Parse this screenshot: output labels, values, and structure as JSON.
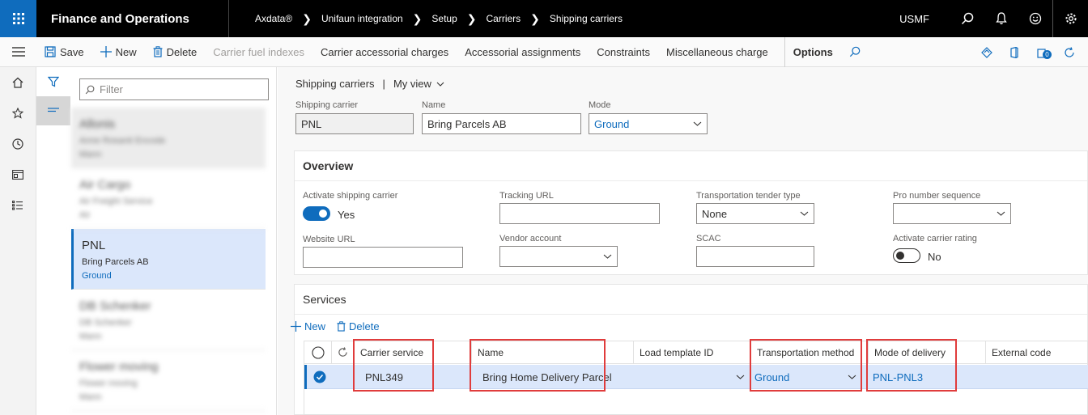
{
  "topbar": {
    "app_title": "Finance and Operations",
    "breadcrumbs": [
      "Axdata®",
      "Unifaun integration",
      "Setup",
      "Carriers",
      "Shipping carriers"
    ],
    "company": "USMF"
  },
  "actionbar": {
    "save": "Save",
    "new": "New",
    "delete": "Delete",
    "carrier_fuel_indexes": "Carrier fuel indexes",
    "carrier_accessorial_charges": "Carrier accessorial charges",
    "accessorial_assignments": "Accessorial assignments",
    "constraints": "Constraints",
    "miscellaneous_charge": "Miscellaneous charge",
    "options": "Options",
    "notification_count": "0"
  },
  "listpane": {
    "filter_placeholder": "Filter",
    "items": [
      {
        "code": "Allonis",
        "name": "Anne Rosanti Encode",
        "mode": "Mann",
        "blurred": true
      },
      {
        "code": "Air Cargo",
        "name": "Air Freight Service",
        "mode": "Air",
        "blurred": true
      },
      {
        "code": "PNL",
        "name": "Bring Parcels AB",
        "mode": "Ground",
        "blurred": false
      },
      {
        "code": "DB Schenker",
        "name": "DB Schenker",
        "mode": "Mann",
        "blurred": true
      },
      {
        "code": "Flower moving",
        "name": "Flower moving",
        "mode": "Mann",
        "blurred": true
      }
    ]
  },
  "detail": {
    "view_title": "Shipping carriers",
    "view_name": "My view",
    "labels": {
      "shipping_carrier": "Shipping carrier",
      "name": "Name",
      "mode": "Mode"
    },
    "values": {
      "shipping_carrier": "PNL",
      "name": "Bring Parcels AB",
      "mode": "Ground"
    }
  },
  "overview": {
    "title": "Overview",
    "activate_shipping_carrier_label": "Activate shipping carrier",
    "activate_shipping_carrier_value": "Yes",
    "tracking_url_label": "Tracking URL",
    "tracking_url_value": "",
    "transportation_tender_type_label": "Transportation tender type",
    "transportation_tender_type_value": "None",
    "pro_number_sequence_label": "Pro number sequence",
    "pro_number_sequence_value": "",
    "website_url_label": "Website URL",
    "website_url_value": "",
    "vendor_account_label": "Vendor account",
    "vendor_account_value": "",
    "scac_label": "SCAC",
    "scac_value": "",
    "activate_carrier_rating_label": "Activate carrier rating",
    "activate_carrier_rating_value": "No"
  },
  "services": {
    "title": "Services",
    "new": "New",
    "delete": "Delete",
    "columns": [
      "Carrier service",
      "Name",
      "Load template ID",
      "Transportation method",
      "Mode of delivery",
      "External code"
    ],
    "rows": [
      {
        "carrier_service": "PNL349",
        "name": "Bring Home Delivery Parcel",
        "load_template_id": "",
        "transportation_method": "Ground",
        "mode_of_delivery": "PNL-PNL3",
        "external_code": ""
      }
    ]
  },
  "colors": {
    "accent": "#0f6cbd",
    "highlight_box": "#e03c3c",
    "topbar": "#000000"
  }
}
